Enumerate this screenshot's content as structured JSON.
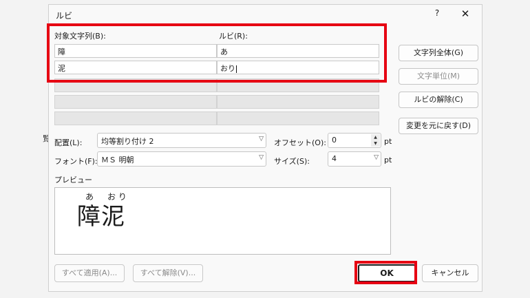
{
  "dialog": {
    "title": "ルビ",
    "help": "?",
    "close": "✕"
  },
  "table": {
    "base_header": "対象文字列(B):",
    "ruby_header": "ルビ(R):",
    "rows": [
      {
        "base": "障",
        "ruby": "あ"
      },
      {
        "base": "泥",
        "ruby": "おり"
      }
    ]
  },
  "side_buttons": {
    "whole": "文字列全体(G)",
    "per_char": "文字単位(M)",
    "remove": "ルビの解除(C)",
    "reset": "変更を元に戻す(D)"
  },
  "options": {
    "align_label": "配置(L):",
    "align_value": "均等割り付け 2",
    "offset_label": "オフセット(O):",
    "offset_value": "0",
    "offset_unit": "pt",
    "font_label": "フォント(F):",
    "font_value": "ＭＳ 明朝",
    "size_label": "サイズ(S):",
    "size_value": "4",
    "size_unit": "pt"
  },
  "preview": {
    "label": "プレビュー",
    "ruby_1": "あ",
    "ruby_2": "お り",
    "base_text": "障泥"
  },
  "bottom_buttons": {
    "apply_all": "すべて適用(A)...",
    "remove_all": "すべて解除(V)...",
    "ok": "OK",
    "cancel": "キャンセル"
  },
  "background": {
    "partial_char": "覧"
  },
  "colors": {
    "highlight": "#e60012"
  }
}
